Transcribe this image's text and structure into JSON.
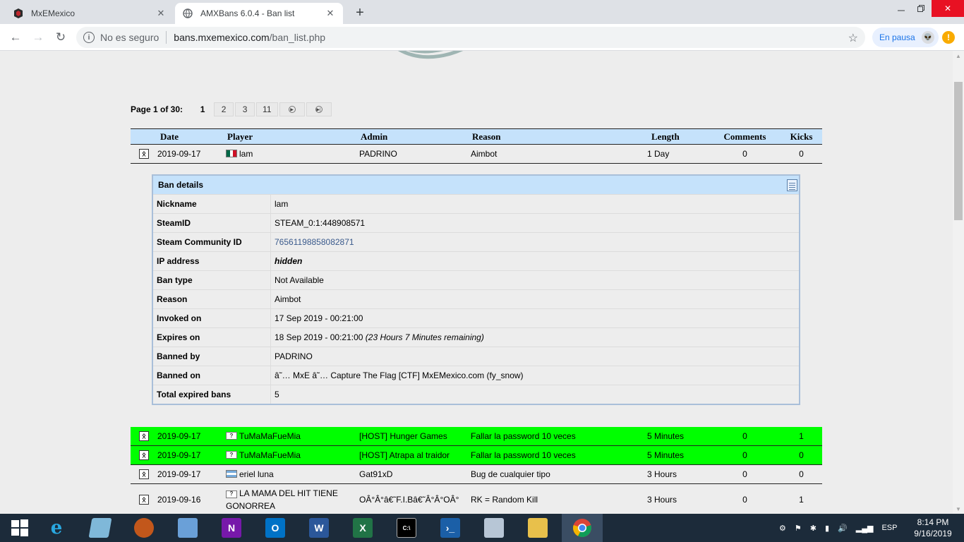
{
  "browser": {
    "tabs": [
      {
        "title": "MxEMexico",
        "active": false
      },
      {
        "title": "AMXBans 6.0.4 - Ban list",
        "active": true
      }
    ],
    "omnibox": {
      "security": "No es seguro",
      "host": "bans.mxemexico.com",
      "path": "/ban_list.php"
    },
    "profile_status": "En pausa"
  },
  "pager": {
    "label": "Page 1 of 30:",
    "current": "1",
    "pages": [
      "2",
      "3",
      "11"
    ]
  },
  "table": {
    "headers": {
      "date": "Date",
      "player": "Player",
      "admin": "Admin",
      "reason": "Reason",
      "length": "Length",
      "comments": "Comments",
      "kicks": "Kicks"
    },
    "first_row": {
      "date": "2019-09-17",
      "player": "lam",
      "flag": "mx",
      "admin": "PADRINO",
      "reason": "Aimbot",
      "length": "1 Day",
      "comments": "0",
      "kicks": "0"
    },
    "rows": [
      {
        "date": "2019-09-17",
        "player": "TuMaMaFueMia",
        "flag": "unknown",
        "admin": "[HOST] Hunger Games",
        "reason": "Fallar la password 10 veces",
        "length": "5 Minutes",
        "comments": "0",
        "kicks": "1",
        "highlight": "#00ff00"
      },
      {
        "date": "2019-09-17",
        "player": "TuMaMaFueMia",
        "flag": "unknown",
        "admin": "[HOST] Atrapa al traidor",
        "reason": "Fallar la password 10 veces",
        "length": "5 Minutes",
        "comments": "0",
        "kicks": "0",
        "highlight": "#00ff00"
      },
      {
        "date": "2019-09-17",
        "player": "eriel luna",
        "flag": "ar",
        "admin": "Gat91xD",
        "reason": "Bug de cualquier tipo",
        "length": "3 Hours",
        "comments": "0",
        "kicks": "0",
        "highlight": ""
      },
      {
        "date": "2019-09-16",
        "player": "LA MAMA DEL HIT TIENE GONORREA",
        "flag": "unknown",
        "admin": "OÂ°Â°â€˜F.I.Bâ€˜Â°Â°OÂ°",
        "reason": "RK = Random Kill",
        "length": "3 Hours",
        "comments": "0",
        "kicks": "1",
        "highlight": ""
      }
    ]
  },
  "details": {
    "title": "Ban details",
    "rows": [
      {
        "key": "Nickname",
        "value": "lam"
      },
      {
        "key": "SteamID",
        "value": "STEAM_0:1:448908571"
      },
      {
        "key": "Steam Community ID",
        "value": "76561198858082871"
      },
      {
        "key": "IP address",
        "value": "hidden"
      },
      {
        "key": "Ban type",
        "value": "Not Available"
      },
      {
        "key": "Reason",
        "value": "Aimbot"
      },
      {
        "key": "Invoked on",
        "value": "17 Sep 2019 - 00:21:00"
      },
      {
        "key": "Expires on",
        "value": "18 Sep 2019 - 00:21:00",
        "note": "(23 Hours 7 Minutes remaining)"
      },
      {
        "key": "Banned by",
        "value": "PADRINO"
      },
      {
        "key": "Banned on",
        "value": "â˜… MxE â˜… Capture The Flag [CTF] MxEMexico.com (fy_snow)"
      },
      {
        "key": "Total expired bans",
        "value": "5"
      }
    ]
  },
  "taskbar": {
    "lang": "ESP",
    "time": "8:14 PM",
    "date": "9/16/2019"
  }
}
